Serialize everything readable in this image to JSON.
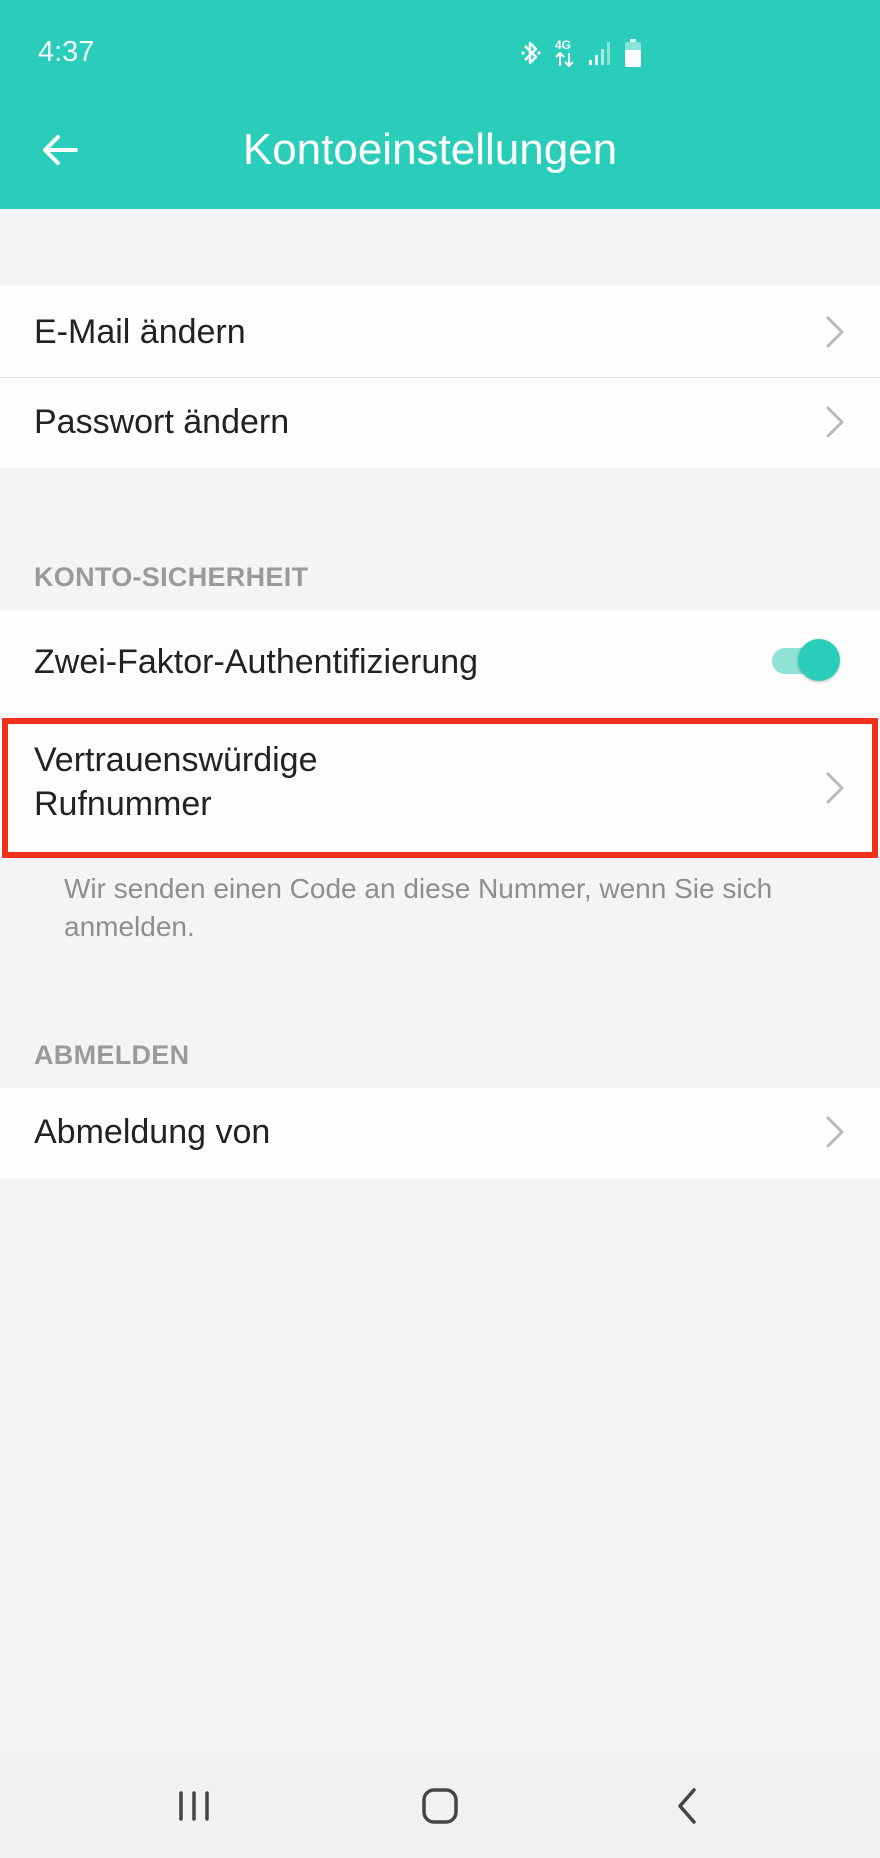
{
  "status_bar": {
    "time": "4:37",
    "icons": [
      "bluetooth-icon",
      "4g-data-icon",
      "signal-icon",
      "battery-icon"
    ],
    "network_label": "4G"
  },
  "header": {
    "title": "Kontoeinstellungen",
    "back_icon": "arrow-left-icon",
    "background_color": "#2acdb9"
  },
  "account_rows": [
    {
      "label": "E-Mail ändern"
    },
    {
      "label": "Passwort ändern"
    }
  ],
  "security_section": {
    "header": "KONTO-SICHERHEIT",
    "two_factor": {
      "label": "Zwei-Faktor-Authentifizierung",
      "enabled": true
    },
    "trusted_number": {
      "line1": "Vertrauenswürdige",
      "line2": "Rufnummer"
    },
    "help_text": "Wir senden einen Code an diese Nummer, wenn Sie sich anmelden."
  },
  "logout_section": {
    "header": "ABMELDEN",
    "logout_row": {
      "label": "Abmeldung von"
    }
  },
  "highlight_color": "#f0301a",
  "nav_bar": {
    "icons": [
      "recent-apps-icon",
      "home-icon",
      "back-icon"
    ]
  }
}
